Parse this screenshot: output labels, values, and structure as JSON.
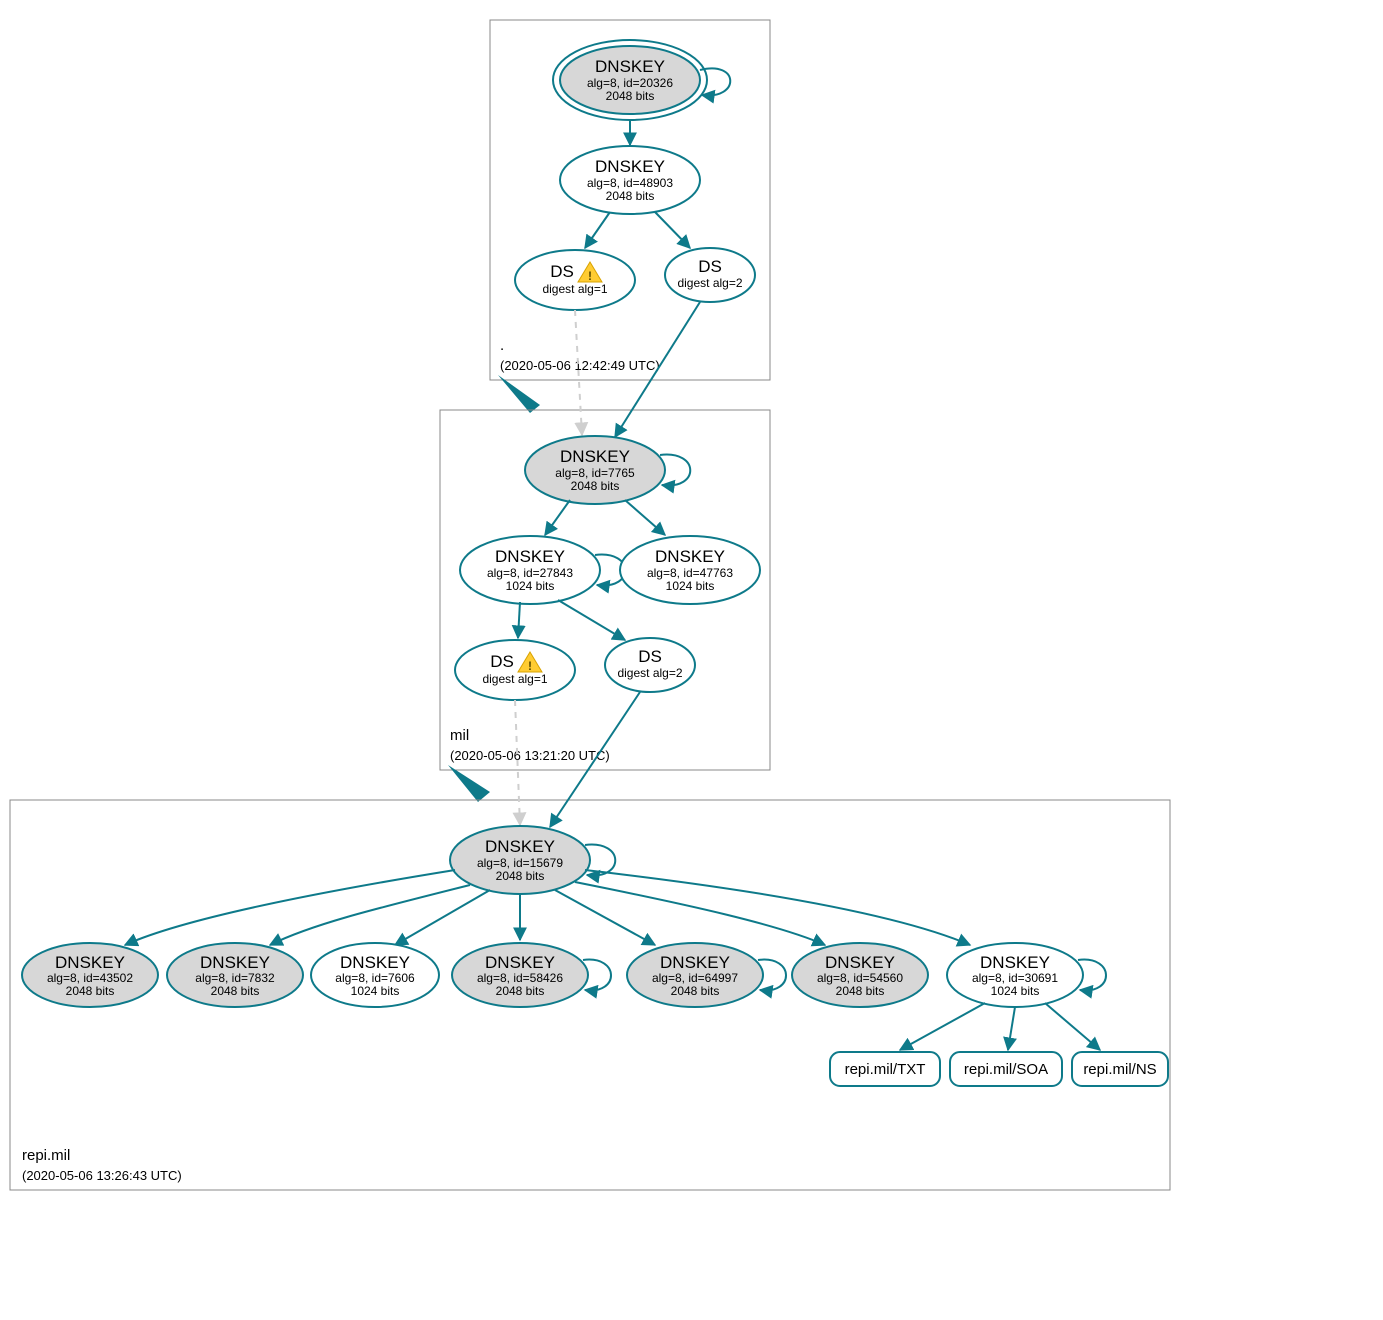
{
  "colors": {
    "accent": "#0e7a8a",
    "node_fill": "#d7d7d7",
    "warn": "#ffcc33"
  },
  "zones": [
    {
      "name": ".",
      "timestamp": "(2020-05-06 12:42:49 UTC)"
    },
    {
      "name": "mil",
      "timestamp": "(2020-05-06 13:21:20 UTC)"
    },
    {
      "name": "repi.mil",
      "timestamp": "(2020-05-06 13:26:43 UTC)"
    }
  ],
  "nodes": {
    "root_ksk": {
      "title": "DNSKEY",
      "sub": "alg=8, id=20326",
      "bits": "2048 bits"
    },
    "root_zsk": {
      "title": "DNSKEY",
      "sub": "alg=8, id=48903",
      "bits": "2048 bits"
    },
    "root_ds1": {
      "title": "DS",
      "sub": "digest alg=1"
    },
    "root_ds2": {
      "title": "DS",
      "sub": "digest alg=2"
    },
    "mil_ksk": {
      "title": "DNSKEY",
      "sub": "alg=8, id=7765",
      "bits": "2048 bits"
    },
    "mil_zsk_a": {
      "title": "DNSKEY",
      "sub": "alg=8, id=27843",
      "bits": "1024 bits"
    },
    "mil_zsk_b": {
      "title": "DNSKEY",
      "sub": "alg=8, id=47763",
      "bits": "1024 bits"
    },
    "mil_ds1": {
      "title": "DS",
      "sub": "digest alg=1"
    },
    "mil_ds2": {
      "title": "DS",
      "sub": "digest alg=2"
    },
    "repi_ksk": {
      "title": "DNSKEY",
      "sub": "alg=8, id=15679",
      "bits": "2048 bits"
    },
    "repi_k1": {
      "title": "DNSKEY",
      "sub": "alg=8, id=43502",
      "bits": "2048 bits"
    },
    "repi_k2": {
      "title": "DNSKEY",
      "sub": "alg=8, id=7832",
      "bits": "2048 bits"
    },
    "repi_k3": {
      "title": "DNSKEY",
      "sub": "alg=8, id=7606",
      "bits": "1024 bits"
    },
    "repi_k4": {
      "title": "DNSKEY",
      "sub": "alg=8, id=58426",
      "bits": "2048 bits"
    },
    "repi_k5": {
      "title": "DNSKEY",
      "sub": "alg=8, id=64997",
      "bits": "2048 bits"
    },
    "repi_k6": {
      "title": "DNSKEY",
      "sub": "alg=8, id=54560",
      "bits": "2048 bits"
    },
    "repi_k7": {
      "title": "DNSKEY",
      "sub": "alg=8, id=30691",
      "bits": "1024 bits"
    }
  },
  "records": {
    "txt": "repi.mil/TXT",
    "soa": "repi.mil/SOA",
    "ns": "repi.mil/NS"
  },
  "icons": {
    "warning": "warning-icon"
  }
}
